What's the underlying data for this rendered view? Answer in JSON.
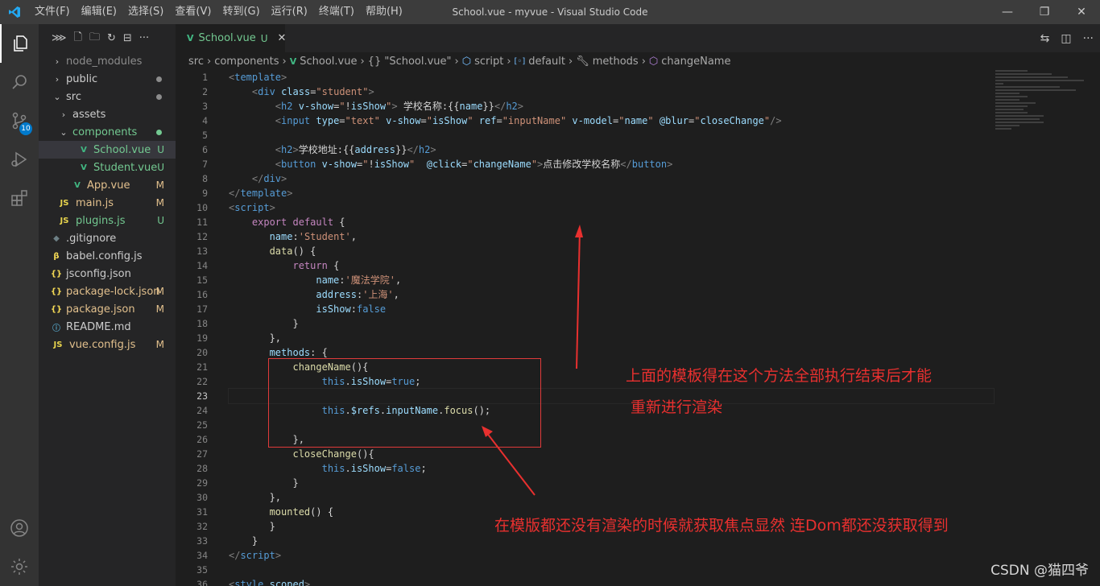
{
  "window": {
    "title": "School.vue - myvue - Visual Studio Code",
    "menu": [
      "文件(F)",
      "编辑(E)",
      "选择(S)",
      "查看(V)",
      "转到(G)",
      "运行(R)",
      "终端(T)",
      "帮助(H)"
    ]
  },
  "activity": {
    "scm_badge": "10"
  },
  "explorer": {
    "items": [
      {
        "label": "node_modules",
        "status": ""
      },
      {
        "label": "public",
        "status": ""
      },
      {
        "label": "src",
        "status": ""
      },
      {
        "label": "assets",
        "status": ""
      },
      {
        "label": "components",
        "status": ""
      },
      {
        "label": "School.vue",
        "status": "U"
      },
      {
        "label": "Student.vue",
        "status": "U"
      },
      {
        "label": "App.vue",
        "status": "M"
      },
      {
        "label": "main.js",
        "status": "M"
      },
      {
        "label": "plugins.js",
        "status": "U"
      },
      {
        "label": ".gitignore",
        "status": ""
      },
      {
        "label": "babel.config.js",
        "status": ""
      },
      {
        "label": "jsconfig.json",
        "status": ""
      },
      {
        "label": "package-lock.json",
        "status": "M"
      },
      {
        "label": "package.json",
        "status": "M"
      },
      {
        "label": "README.md",
        "status": ""
      },
      {
        "label": "vue.config.js",
        "status": "M"
      }
    ],
    "file_icons": {
      "vue": "V",
      "js": "JS",
      "json": "{}",
      "info": "ⓘ",
      "git": "◆",
      "babel": "β"
    }
  },
  "tab": {
    "label": "School.vue",
    "status": "U"
  },
  "breadcrumb": [
    "src",
    "components",
    "School.vue",
    "{} \"School.vue\"",
    "script",
    "default",
    "methods",
    "changeName"
  ],
  "editor": {
    "current_line": 23,
    "line_numbers": [
      "1",
      "2",
      "3",
      "4",
      "5",
      "6",
      "7",
      "8",
      "9",
      "10",
      "11",
      "12",
      "13",
      "14",
      "15",
      "16",
      "17",
      "18",
      "19",
      "20",
      "21",
      "22",
      "23",
      "24",
      "25",
      "26",
      "27",
      "28",
      "29",
      "30",
      "31",
      "32",
      "33",
      "34",
      "35",
      "36"
    ]
  },
  "annotations": {
    "note1_line1": "上面的模板得在这个方法全部执行结束后才能",
    "note1_line2": "重新进行渲染",
    "note2": "在模版都还没有渲染的时候就获取焦点显然 连Dom都还没获取得到",
    "watermark": "CSDN @猫四爷"
  },
  "colors": {
    "vue_green": "#41b883",
    "git_untracked": "#73c991",
    "git_modified": "#e2c08d",
    "annotation_red": "#e8302f",
    "accent_blue": "#007acc"
  }
}
